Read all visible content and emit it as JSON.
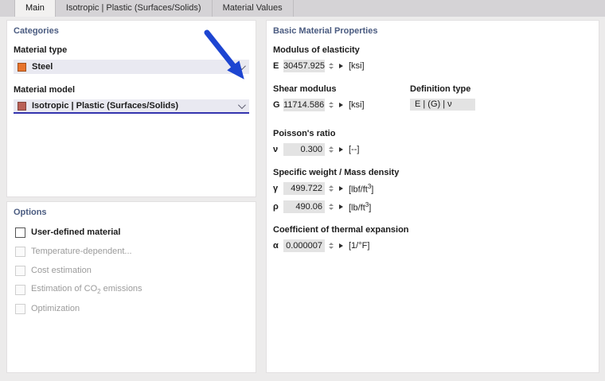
{
  "tabs": {
    "main": "Main",
    "isotropic": "Isotropic | Plastic (Surfaces/Solids)",
    "material_values": "Material Values"
  },
  "categories": {
    "title": "Categories",
    "material_type_label": "Material type",
    "material_type_value": "Steel",
    "material_model_label": "Material model",
    "material_model_value": "Isotropic | Plastic (Surfaces/Solids)"
  },
  "options": {
    "title": "Options",
    "user_defined": {
      "label": "User-defined material",
      "checked": false,
      "enabled": true
    },
    "temperature": {
      "label": "Temperature-dependent...",
      "checked": false,
      "enabled": false
    },
    "cost": {
      "label": "Cost estimation",
      "checked": false,
      "enabled": false
    },
    "co2": {
      "label_pre": "Estimation of CO",
      "label_sub": "2",
      "label_post": " emissions",
      "checked": false,
      "enabled": false
    },
    "optimization": {
      "label": "Optimization",
      "checked": false,
      "enabled": false
    }
  },
  "properties": {
    "title": "Basic Material Properties",
    "modulus": {
      "label": "Modulus of elasticity",
      "symbol": "E",
      "value": "30457.925",
      "unit": "[ksi]"
    },
    "shear": {
      "label": "Shear modulus",
      "symbol": "G",
      "value": "11714.586",
      "unit": "[ksi]"
    },
    "definition_type": {
      "label": "Definition type",
      "value": "E | (G) | ν"
    },
    "poisson": {
      "label": "Poisson's ratio",
      "symbol": "ν",
      "value": "0.300",
      "unit": "[--]"
    },
    "specific_weight": {
      "label": "Specific weight / Mass density",
      "gamma": {
        "symbol": "γ",
        "value": "499.722",
        "unit_pre": "[lbf/ft",
        "unit_sup": "3",
        "unit_post": "]"
      },
      "rho": {
        "symbol": "ρ",
        "value": "490.06",
        "unit_pre": "[lb/ft",
        "unit_sup": "3",
        "unit_post": "]"
      }
    },
    "thermal": {
      "label": "Coefficient of thermal expansion",
      "symbol": "α",
      "value": "0.000007",
      "unit": "[1/°F]"
    }
  },
  "colors": {
    "steel_swatch": "#e8742c",
    "model_swatch": "#b96057",
    "arrow_blue": "#1d45d1",
    "heading_blue": "#4a5b80",
    "focus_underline": "#3434ae"
  }
}
